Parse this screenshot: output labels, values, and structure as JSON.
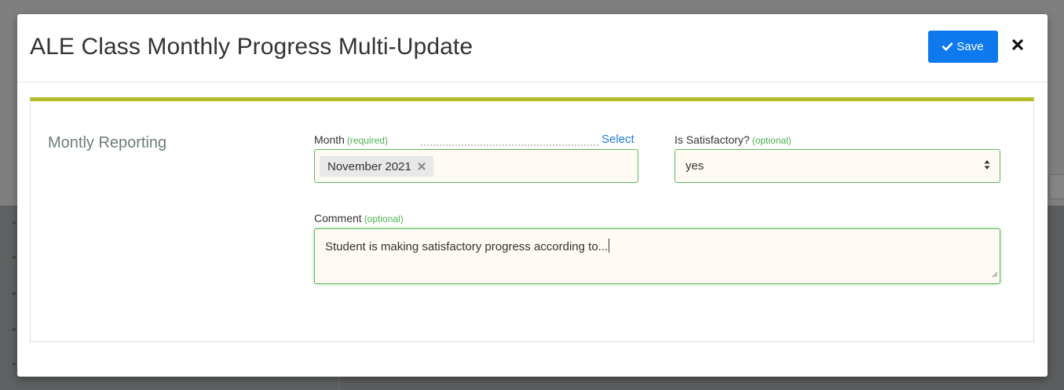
{
  "modal": {
    "title": "ALE Class Monthly Progress Multi-Update",
    "save_label": "Save"
  },
  "section": {
    "title": "Montly Reporting"
  },
  "month": {
    "label": "Month",
    "hint": "(required)",
    "select_link": "Select",
    "selected_tag": "November 2021"
  },
  "satisfactory": {
    "label": "Is Satisfactory?",
    "hint": "(optional)",
    "value": "yes"
  },
  "comment": {
    "label": "Comment",
    "hint": "(optional)",
    "value": "Student is making satisfactory progress according to..."
  },
  "colors": {
    "accent": "#0d79ed",
    "panel_top_border": "#b4ba24",
    "field_border": "#5cb85c",
    "hint_text": "#4caf50",
    "link": "#1f7ae0"
  },
  "icons": {
    "save": "check-icon",
    "close": "close-icon",
    "tag_remove": "x-icon",
    "select_caret": "sort-caret-icon",
    "textarea_resize": "resize-grip-icon"
  }
}
